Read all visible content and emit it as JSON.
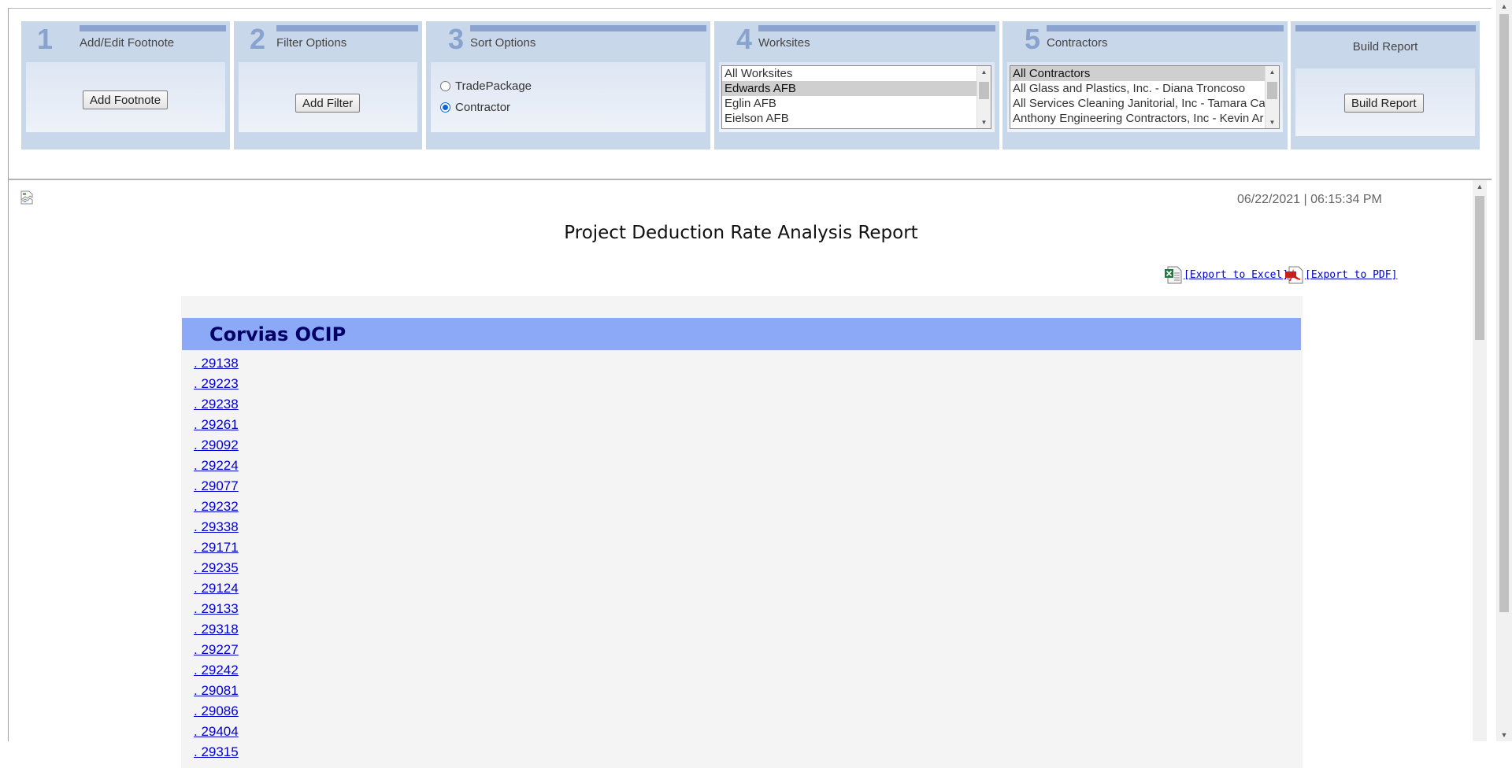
{
  "toolbar": {
    "panels": [
      {
        "num": "1",
        "title": "Add/Edit Footnote",
        "button": "Add Footnote"
      },
      {
        "num": "2",
        "title": "Filter Options",
        "button": "Add Filter"
      },
      {
        "num": "3",
        "title": "Sort Options",
        "radios": [
          {
            "label": "TradePackage",
            "checked": false
          },
          {
            "label": "Contractor",
            "checked": true
          }
        ]
      },
      {
        "num": "4",
        "title": "Worksites",
        "options": [
          "All Worksites",
          "Edwards AFB",
          "Eglin AFB",
          "Eielson AFB"
        ],
        "selected": "Edwards AFB"
      },
      {
        "num": "5",
        "title": "Contractors",
        "options": [
          "All Contractors",
          "All Glass and Plastics, Inc. - Diana Troncoso",
          "All Services Cleaning Janitorial, Inc - Tamara Ca",
          "Anthony Engineering Contractors, Inc - Kevin Ar"
        ],
        "selected": "All Contractors"
      },
      {
        "title": "Build Report",
        "button": "Build Report"
      }
    ]
  },
  "report": {
    "timestamp": "06/22/2021 | 06:15:34 PM",
    "title": "Project Deduction Rate Analysis Report",
    "export_excel": "[Export to Excel]",
    "export_pdf": "[Export to PDF]",
    "group_title": "Corvias OCIP",
    "links": [
      ". 29138",
      ". 29223",
      ". 29238",
      ". 29261",
      ". 29092",
      ". 29224",
      ". 29077",
      ". 29232",
      ". 29338",
      ". 29171",
      ". 29235",
      ". 29124",
      ". 29133",
      ". 29318",
      ". 29227",
      ". 29242",
      ". 29081",
      ". 29086",
      ". 29404",
      ". 29315"
    ]
  },
  "icons": {
    "excel": "excel-file-icon",
    "pdf": "pdf-file-icon",
    "broken_image": "broken-image-icon"
  },
  "colors": {
    "panel_bg": "#c9d7ea",
    "panel_stripe": "#8aa4cf",
    "group_header": "#8ba9f7",
    "group_header_text": "#000066",
    "link": "#0000cc"
  }
}
